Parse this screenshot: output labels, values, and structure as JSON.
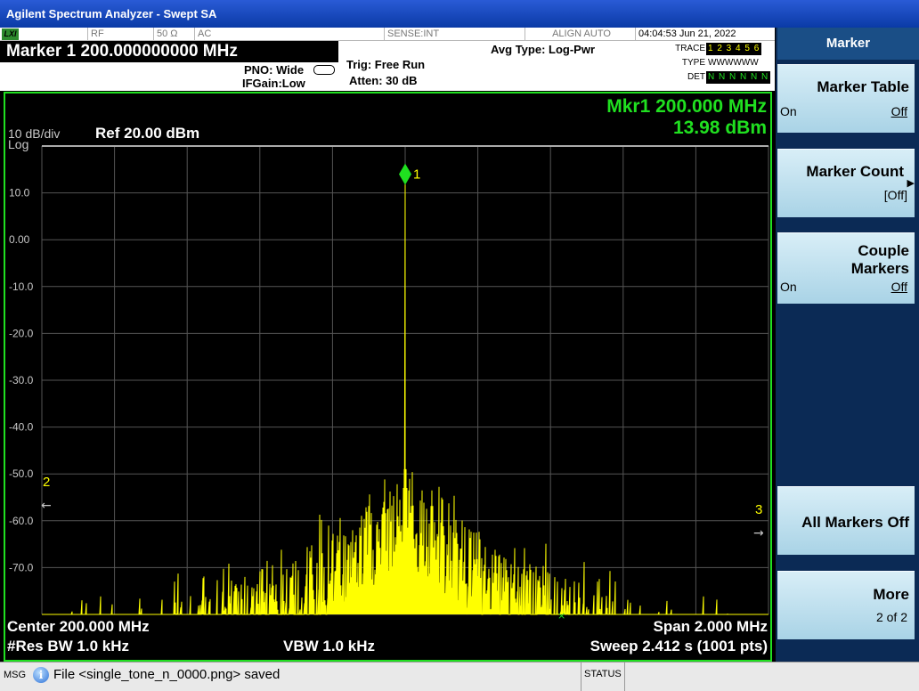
{
  "window": {
    "title": "Agilent Spectrum Analyzer - Swept SA"
  },
  "status_row": {
    "logo": "LXI",
    "rf": "RF",
    "impedance": "50 Ω",
    "coupling": "AC",
    "sense": "SENSE:INT",
    "align": "ALIGN AUTO",
    "datetime": "04:04:53 Jun 21, 2022"
  },
  "settings": {
    "marker_readout": "Marker 1 200.000000000 MHz",
    "pno": "PNO: Wide",
    "ifgain": "IFGain:Low",
    "trig": "Trig: Free Run",
    "atten": "Atten: 30 dB",
    "avg_type": "Avg Type: Log-Pwr"
  },
  "trace_panel": {
    "trace_label": "TRACE",
    "type_label": "TYPE",
    "det_label": "DET",
    "trace_values": "1 2 3 4 5 6",
    "type_values": "WWWWWW",
    "det_values": "N N N N N N"
  },
  "plot": {
    "scale": "10 dB/div",
    "ref": "Ref 20.00 dBm",
    "log_label": "Log",
    "mkr_freq": "Mkr1 200.000 MHz",
    "mkr_amp": "13.98 dBm",
    "marker_number": "1",
    "left_marker_number": "2",
    "right_marker_number": "3",
    "y_ticks": [
      "10.0",
      "0.00",
      "-10.0",
      "-20.0",
      "-30.0",
      "-40.0",
      "-50.0",
      "-60.0",
      "-70.0"
    ],
    "center": "Center 200.000 MHz",
    "span": "Span 2.000 MHz",
    "res_bw": "#Res BW 1.0 kHz",
    "vbw": "VBW 1.0 kHz",
    "sweep": "Sweep  2.412 s (1001 pts)",
    "colors": {
      "trace": "#ffff00",
      "readout": "#20e020",
      "grid": "#555555",
      "frame": "#20e020"
    }
  },
  "chart_data": {
    "type": "line",
    "xlabel": "",
    "ylabel": "",
    "x_range_mhz": [
      199.0,
      201.0
    ],
    "ylim": [
      -80,
      20
    ],
    "ref_level_dbm": 20.0,
    "scale_db_per_div": 10,
    "series": [
      {
        "x": [
          199.0,
          199.3,
          199.5,
          199.6,
          199.7,
          199.8,
          199.9,
          199.95,
          199.98,
          200.0,
          200.02,
          200.05,
          200.1,
          200.2,
          200.3,
          200.4,
          200.5,
          200.7,
          201.0
        ],
        "values": [
          -80,
          -80,
          -79,
          -77,
          -75,
          -74,
          -70,
          -65,
          -50,
          13.98,
          -50,
          -62,
          -70,
          -74,
          -76,
          -78,
          -79,
          -80,
          -80
        ]
      }
    ],
    "marker_1": {
      "x_mhz": 200.0,
      "y_dbm": 13.98
    }
  },
  "softkeys": {
    "menu_title": "Marker",
    "marker_table": {
      "label": "Marker Table",
      "on": "On",
      "off": "Off"
    },
    "marker_count": {
      "label": "Marker Count",
      "value": "[Off]"
    },
    "couple_markers": {
      "label1": "Couple",
      "label2": "Markers",
      "on": "On",
      "off": "Off"
    },
    "all_markers_off": {
      "label": "All Markers Off"
    },
    "more": {
      "label": "More",
      "page": "2 of 2"
    }
  },
  "message_bar": {
    "msg_label": "MSG",
    "message": "File <single_tone_n_0000.png> saved",
    "status_label": "STATUS"
  }
}
